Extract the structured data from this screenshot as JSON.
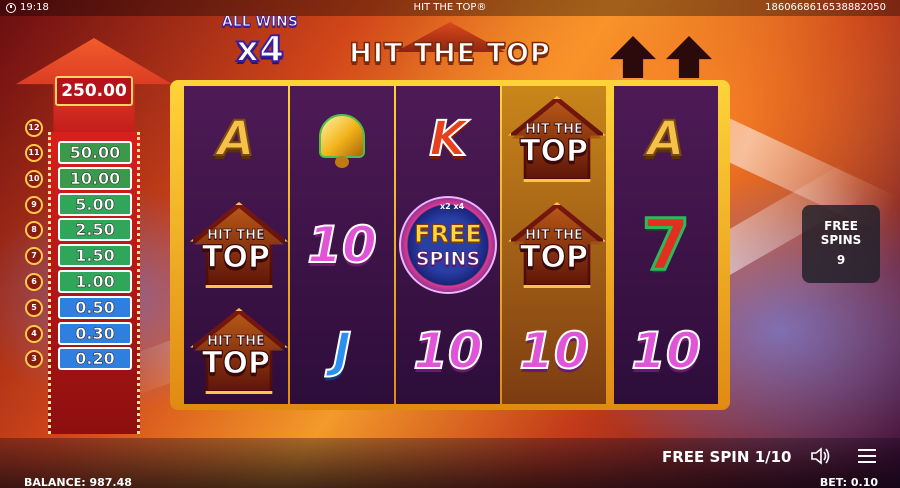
{
  "status_bar": {
    "time": "19:18",
    "title": "HIT THE TOP®",
    "session_id": "18606686165388820​50"
  },
  "multiplier": {
    "label": "ALL WINS",
    "value": "x4"
  },
  "logo": "HIT THE TOP",
  "ladder": {
    "top_prize": "250.00",
    "rungs": [
      {
        "level": "11",
        "value": "50.00",
        "color": "#3a9a4a"
      },
      {
        "level": "10",
        "value": "10.00",
        "color": "#3a9a4a"
      },
      {
        "level": "9",
        "value": "5.00",
        "color": "#2fa65a"
      },
      {
        "level": "8",
        "value": "2.50",
        "color": "#2fa65a"
      },
      {
        "level": "7",
        "value": "1.50",
        "color": "#2fa65a"
      },
      {
        "level": "6",
        "value": "1.00",
        "color": "#2fa65a"
      },
      {
        "level": "5",
        "value": "0.50",
        "color": "#2f7fe0"
      },
      {
        "level": "4",
        "value": "0.30",
        "color": "#2f7fe0"
      },
      {
        "level": "3",
        "value": "0.20",
        "color": "#2f7fe0"
      }
    ],
    "top_level": "12"
  },
  "reels": [
    {
      "symbols": [
        "A",
        "HIT THE TOP",
        "HIT THE TOP"
      ]
    },
    {
      "symbols": [
        "bell",
        "10",
        "J"
      ]
    },
    {
      "symbols": [
        "K",
        "FREE SPINS",
        "10"
      ]
    },
    {
      "symbols": [
        "HIT THE TOP",
        "HIT THE TOP",
        "10"
      ]
    },
    {
      "symbols": [
        "A",
        "7",
        "10"
      ]
    }
  ],
  "symbol_text": {
    "hit_the": "HIT THE",
    "top": "TOP",
    "free": "FREE",
    "spins": "SPINS",
    "fs_tag": "x2 x4"
  },
  "free_spins_panel": {
    "label": "FREE SPINS",
    "count": "9"
  },
  "bottom": {
    "free_spin_label": "FREE SPIN",
    "free_spin_progress": "1/10",
    "balance_label": "BALANCE:",
    "balance": "987.48",
    "bet_label": "BET:",
    "bet": "0.10"
  },
  "colors": {
    "reel_bg": "#3a1246",
    "frame_gold": "#f4b21e",
    "ladder_red": "#c41b1b"
  }
}
